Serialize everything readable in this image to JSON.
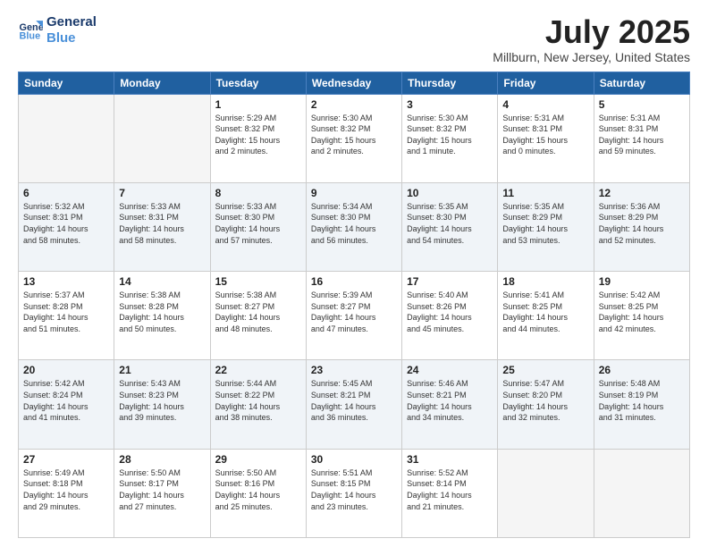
{
  "header": {
    "logo_line1": "General",
    "logo_line2": "Blue",
    "title": "July 2025",
    "subtitle": "Millburn, New Jersey, United States"
  },
  "days_of_week": [
    "Sunday",
    "Monday",
    "Tuesday",
    "Wednesday",
    "Thursday",
    "Friday",
    "Saturday"
  ],
  "weeks": [
    [
      {
        "day": "",
        "info": ""
      },
      {
        "day": "",
        "info": ""
      },
      {
        "day": "1",
        "info": "Sunrise: 5:29 AM\nSunset: 8:32 PM\nDaylight: 15 hours\nand 2 minutes."
      },
      {
        "day": "2",
        "info": "Sunrise: 5:30 AM\nSunset: 8:32 PM\nDaylight: 15 hours\nand 2 minutes."
      },
      {
        "day": "3",
        "info": "Sunrise: 5:30 AM\nSunset: 8:32 PM\nDaylight: 15 hours\nand 1 minute."
      },
      {
        "day": "4",
        "info": "Sunrise: 5:31 AM\nSunset: 8:31 PM\nDaylight: 15 hours\nand 0 minutes."
      },
      {
        "day": "5",
        "info": "Sunrise: 5:31 AM\nSunset: 8:31 PM\nDaylight: 14 hours\nand 59 minutes."
      }
    ],
    [
      {
        "day": "6",
        "info": "Sunrise: 5:32 AM\nSunset: 8:31 PM\nDaylight: 14 hours\nand 58 minutes."
      },
      {
        "day": "7",
        "info": "Sunrise: 5:33 AM\nSunset: 8:31 PM\nDaylight: 14 hours\nand 58 minutes."
      },
      {
        "day": "8",
        "info": "Sunrise: 5:33 AM\nSunset: 8:30 PM\nDaylight: 14 hours\nand 57 minutes."
      },
      {
        "day": "9",
        "info": "Sunrise: 5:34 AM\nSunset: 8:30 PM\nDaylight: 14 hours\nand 56 minutes."
      },
      {
        "day": "10",
        "info": "Sunrise: 5:35 AM\nSunset: 8:30 PM\nDaylight: 14 hours\nand 54 minutes."
      },
      {
        "day": "11",
        "info": "Sunrise: 5:35 AM\nSunset: 8:29 PM\nDaylight: 14 hours\nand 53 minutes."
      },
      {
        "day": "12",
        "info": "Sunrise: 5:36 AM\nSunset: 8:29 PM\nDaylight: 14 hours\nand 52 minutes."
      }
    ],
    [
      {
        "day": "13",
        "info": "Sunrise: 5:37 AM\nSunset: 8:28 PM\nDaylight: 14 hours\nand 51 minutes."
      },
      {
        "day": "14",
        "info": "Sunrise: 5:38 AM\nSunset: 8:28 PM\nDaylight: 14 hours\nand 50 minutes."
      },
      {
        "day": "15",
        "info": "Sunrise: 5:38 AM\nSunset: 8:27 PM\nDaylight: 14 hours\nand 48 minutes."
      },
      {
        "day": "16",
        "info": "Sunrise: 5:39 AM\nSunset: 8:27 PM\nDaylight: 14 hours\nand 47 minutes."
      },
      {
        "day": "17",
        "info": "Sunrise: 5:40 AM\nSunset: 8:26 PM\nDaylight: 14 hours\nand 45 minutes."
      },
      {
        "day": "18",
        "info": "Sunrise: 5:41 AM\nSunset: 8:25 PM\nDaylight: 14 hours\nand 44 minutes."
      },
      {
        "day": "19",
        "info": "Sunrise: 5:42 AM\nSunset: 8:25 PM\nDaylight: 14 hours\nand 42 minutes."
      }
    ],
    [
      {
        "day": "20",
        "info": "Sunrise: 5:42 AM\nSunset: 8:24 PM\nDaylight: 14 hours\nand 41 minutes."
      },
      {
        "day": "21",
        "info": "Sunrise: 5:43 AM\nSunset: 8:23 PM\nDaylight: 14 hours\nand 39 minutes."
      },
      {
        "day": "22",
        "info": "Sunrise: 5:44 AM\nSunset: 8:22 PM\nDaylight: 14 hours\nand 38 minutes."
      },
      {
        "day": "23",
        "info": "Sunrise: 5:45 AM\nSunset: 8:21 PM\nDaylight: 14 hours\nand 36 minutes."
      },
      {
        "day": "24",
        "info": "Sunrise: 5:46 AM\nSunset: 8:21 PM\nDaylight: 14 hours\nand 34 minutes."
      },
      {
        "day": "25",
        "info": "Sunrise: 5:47 AM\nSunset: 8:20 PM\nDaylight: 14 hours\nand 32 minutes."
      },
      {
        "day": "26",
        "info": "Sunrise: 5:48 AM\nSunset: 8:19 PM\nDaylight: 14 hours\nand 31 minutes."
      }
    ],
    [
      {
        "day": "27",
        "info": "Sunrise: 5:49 AM\nSunset: 8:18 PM\nDaylight: 14 hours\nand 29 minutes."
      },
      {
        "day": "28",
        "info": "Sunrise: 5:50 AM\nSunset: 8:17 PM\nDaylight: 14 hours\nand 27 minutes."
      },
      {
        "day": "29",
        "info": "Sunrise: 5:50 AM\nSunset: 8:16 PM\nDaylight: 14 hours\nand 25 minutes."
      },
      {
        "day": "30",
        "info": "Sunrise: 5:51 AM\nSunset: 8:15 PM\nDaylight: 14 hours\nand 23 minutes."
      },
      {
        "day": "31",
        "info": "Sunrise: 5:52 AM\nSunset: 8:14 PM\nDaylight: 14 hours\nand 21 minutes."
      },
      {
        "day": "",
        "info": ""
      },
      {
        "day": "",
        "info": ""
      }
    ]
  ]
}
